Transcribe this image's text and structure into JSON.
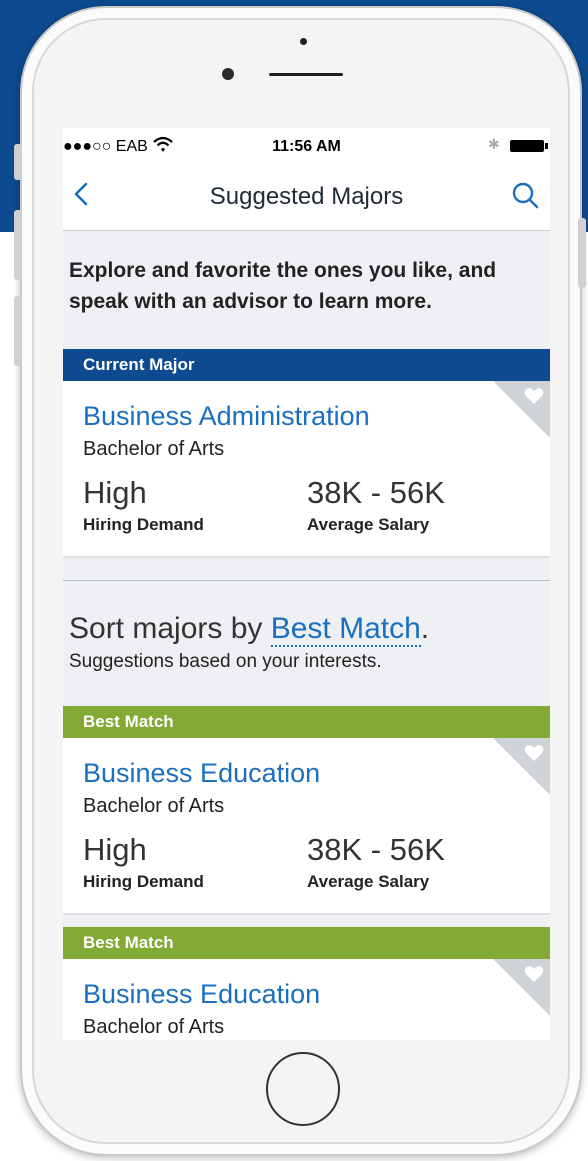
{
  "status": {
    "carrier": "●●●○○ EAB",
    "time": "11:56 AM"
  },
  "nav": {
    "title": "Suggested Majors",
    "back_icon": "chevron-left-icon",
    "search_icon": "search-icon"
  },
  "intro": "Explore and favorite the ones you like, and speak with an advisor to learn more.",
  "current_major": {
    "header": "Current Major",
    "title": "Business Administration",
    "degree": "Bachelor of Arts",
    "demand_value": "High",
    "demand_label": "Hiring Demand",
    "salary_value": "38K - 56K",
    "salary_label": "Average Salary"
  },
  "sort": {
    "prefix": "Sort majors by ",
    "link": "Best Match",
    "suffix": ".",
    "subtitle": "Suggestions based on your interests."
  },
  "suggestions": [
    {
      "header": "Best Match",
      "title": "Business Education",
      "degree": "Bachelor of Arts",
      "demand_value": "High",
      "demand_label": "Hiring Demand",
      "salary_value": "38K - 56K",
      "salary_label": "Average Salary"
    },
    {
      "header": "Best Match",
      "title": "Business Education",
      "degree": "Bachelor of Arts"
    }
  ],
  "colors": {
    "brand_blue": "#0d4a8f",
    "match_green": "#82aa34",
    "link_blue": "#1a6fc0"
  }
}
